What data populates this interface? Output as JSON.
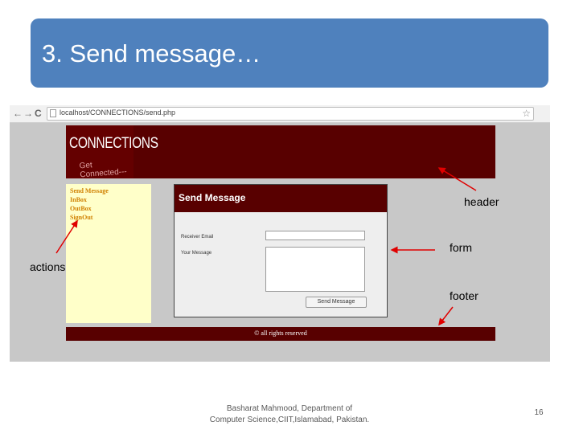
{
  "slide": {
    "title": "3. Send message…",
    "credit_line1": "Basharat Mahmood, Department of",
    "credit_line2": "Computer Science,CIIT,Islamabad, Pakistan.",
    "slide_number": "16"
  },
  "browser": {
    "back": "←",
    "forward": "→",
    "reload": "C",
    "url": "localhost/CONNECTIONS/send.php",
    "star": "☆"
  },
  "site": {
    "logo_main": "CONNECTIONS",
    "logo_sub": "Get Connected---",
    "nav_items": [
      "Send Message",
      "InBox",
      "OutBox",
      "SignOut"
    ],
    "panel_title": "Send Message",
    "receiver_label": "Receiver Email",
    "message_label": "Your Message",
    "receiver_value": "",
    "message_value": "",
    "submit_label": "Send Message",
    "footer": "© all rights reserved"
  },
  "annotations": {
    "header": "header",
    "form": "form",
    "actions": "actions",
    "footer": "footer"
  },
  "colors": {
    "title_bar": "#4f81bd",
    "site_maroon": "#580000",
    "sidebar_bg": "#ffffc9",
    "nav_link": "#d08000",
    "arrow_red": "#e00000"
  }
}
